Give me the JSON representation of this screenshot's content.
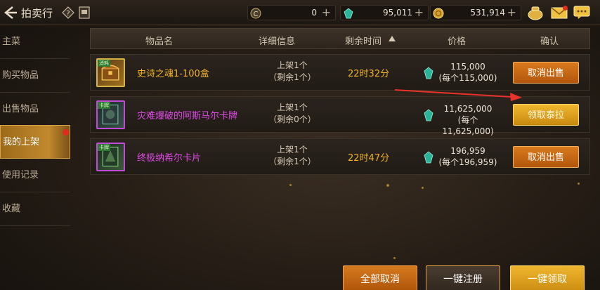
{
  "header": {
    "title": "拍卖行",
    "currencies": [
      {
        "icon": "c-coin-icon",
        "value": "0"
      },
      {
        "icon": "green-gem-icon",
        "value": "95,011"
      },
      {
        "icon": "gold-coin-icon",
        "value": "531,914"
      }
    ]
  },
  "sidebar": {
    "items": [
      {
        "label": "主菜"
      },
      {
        "label": "购买物品"
      },
      {
        "label": "出售物品"
      },
      {
        "label": "我的上架"
      },
      {
        "label": "使用记录"
      },
      {
        "label": "收藏"
      }
    ],
    "active_index": 3
  },
  "table": {
    "columns": [
      "物品名",
      "详细信息",
      "剩余时间",
      "价格",
      "确认"
    ],
    "rows": [
      {
        "name": "史诗之魂1-100盒",
        "name_color": "#f0b329",
        "icon_tag": "消耗",
        "detail_line1": "上架1个",
        "detail_line2": "（剩余1个）",
        "time": "22时32分",
        "price": "115,000",
        "unit_price": "(每个115,000)",
        "action": "取消出售",
        "action_style": "orange"
      },
      {
        "name": "灾难爆破的阿斯马尔卡牌",
        "name_color": "#e04ae8",
        "icon_tag": "卡牌",
        "detail_line1": "上架1个",
        "detail_line2": "（剩余0个）",
        "time": "",
        "price": "11,625,000",
        "unit_price": "(每个11,625,000)",
        "action": "领取泰拉",
        "action_style": "yellow"
      },
      {
        "name": "终极纳希尔卡片",
        "name_color": "#e04ae8",
        "icon_tag": "卡牌",
        "detail_line1": "上架1个",
        "detail_line2": "（剩余1个）",
        "time": "22时47分",
        "price": "196,959",
        "unit_price": "(每个196,959)",
        "action": "取消出售",
        "action_style": "orange"
      }
    ]
  },
  "footer": {
    "cancel_all": "全部取消",
    "register_all": "一键注册",
    "claim_all": "一键领取"
  }
}
